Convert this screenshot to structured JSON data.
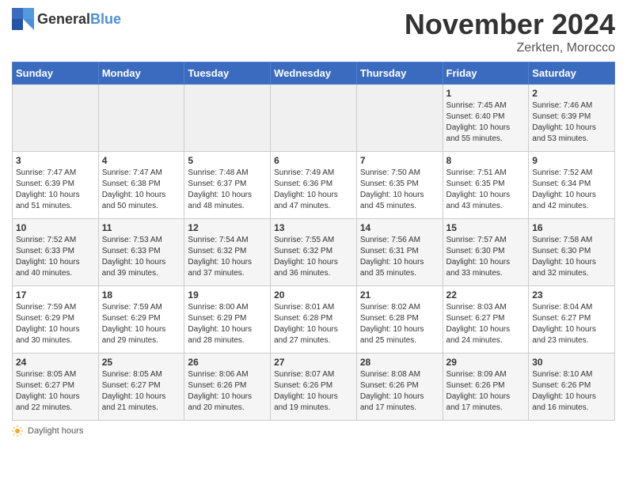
{
  "header": {
    "logo_general": "General",
    "logo_blue": "Blue",
    "month_title": "November 2024",
    "location": "Zerkten, Morocco"
  },
  "days_of_week": [
    "Sunday",
    "Monday",
    "Tuesday",
    "Wednesday",
    "Thursday",
    "Friday",
    "Saturday"
  ],
  "footer": {
    "daylight_hours_label": "Daylight hours"
  },
  "weeks": [
    {
      "days": [
        {
          "num": "",
          "info": ""
        },
        {
          "num": "",
          "info": ""
        },
        {
          "num": "",
          "info": ""
        },
        {
          "num": "",
          "info": ""
        },
        {
          "num": "",
          "info": ""
        },
        {
          "num": "1",
          "info": "Sunrise: 7:45 AM\nSunset: 6:40 PM\nDaylight: 10 hours and 55 minutes."
        },
        {
          "num": "2",
          "info": "Sunrise: 7:46 AM\nSunset: 6:39 PM\nDaylight: 10 hours and 53 minutes."
        }
      ]
    },
    {
      "days": [
        {
          "num": "3",
          "info": "Sunrise: 7:47 AM\nSunset: 6:39 PM\nDaylight: 10 hours and 51 minutes."
        },
        {
          "num": "4",
          "info": "Sunrise: 7:47 AM\nSunset: 6:38 PM\nDaylight: 10 hours and 50 minutes."
        },
        {
          "num": "5",
          "info": "Sunrise: 7:48 AM\nSunset: 6:37 PM\nDaylight: 10 hours and 48 minutes."
        },
        {
          "num": "6",
          "info": "Sunrise: 7:49 AM\nSunset: 6:36 PM\nDaylight: 10 hours and 47 minutes."
        },
        {
          "num": "7",
          "info": "Sunrise: 7:50 AM\nSunset: 6:35 PM\nDaylight: 10 hours and 45 minutes."
        },
        {
          "num": "8",
          "info": "Sunrise: 7:51 AM\nSunset: 6:35 PM\nDaylight: 10 hours and 43 minutes."
        },
        {
          "num": "9",
          "info": "Sunrise: 7:52 AM\nSunset: 6:34 PM\nDaylight: 10 hours and 42 minutes."
        }
      ]
    },
    {
      "days": [
        {
          "num": "10",
          "info": "Sunrise: 7:52 AM\nSunset: 6:33 PM\nDaylight: 10 hours and 40 minutes."
        },
        {
          "num": "11",
          "info": "Sunrise: 7:53 AM\nSunset: 6:33 PM\nDaylight: 10 hours and 39 minutes."
        },
        {
          "num": "12",
          "info": "Sunrise: 7:54 AM\nSunset: 6:32 PM\nDaylight: 10 hours and 37 minutes."
        },
        {
          "num": "13",
          "info": "Sunrise: 7:55 AM\nSunset: 6:32 PM\nDaylight: 10 hours and 36 minutes."
        },
        {
          "num": "14",
          "info": "Sunrise: 7:56 AM\nSunset: 6:31 PM\nDaylight: 10 hours and 35 minutes."
        },
        {
          "num": "15",
          "info": "Sunrise: 7:57 AM\nSunset: 6:30 PM\nDaylight: 10 hours and 33 minutes."
        },
        {
          "num": "16",
          "info": "Sunrise: 7:58 AM\nSunset: 6:30 PM\nDaylight: 10 hours and 32 minutes."
        }
      ]
    },
    {
      "days": [
        {
          "num": "17",
          "info": "Sunrise: 7:59 AM\nSunset: 6:29 PM\nDaylight: 10 hours and 30 minutes."
        },
        {
          "num": "18",
          "info": "Sunrise: 7:59 AM\nSunset: 6:29 PM\nDaylight: 10 hours and 29 minutes."
        },
        {
          "num": "19",
          "info": "Sunrise: 8:00 AM\nSunset: 6:29 PM\nDaylight: 10 hours and 28 minutes."
        },
        {
          "num": "20",
          "info": "Sunrise: 8:01 AM\nSunset: 6:28 PM\nDaylight: 10 hours and 27 minutes."
        },
        {
          "num": "21",
          "info": "Sunrise: 8:02 AM\nSunset: 6:28 PM\nDaylight: 10 hours and 25 minutes."
        },
        {
          "num": "22",
          "info": "Sunrise: 8:03 AM\nSunset: 6:27 PM\nDaylight: 10 hours and 24 minutes."
        },
        {
          "num": "23",
          "info": "Sunrise: 8:04 AM\nSunset: 6:27 PM\nDaylight: 10 hours and 23 minutes."
        }
      ]
    },
    {
      "days": [
        {
          "num": "24",
          "info": "Sunrise: 8:05 AM\nSunset: 6:27 PM\nDaylight: 10 hours and 22 minutes."
        },
        {
          "num": "25",
          "info": "Sunrise: 8:05 AM\nSunset: 6:27 PM\nDaylight: 10 hours and 21 minutes."
        },
        {
          "num": "26",
          "info": "Sunrise: 8:06 AM\nSunset: 6:26 PM\nDaylight: 10 hours and 20 minutes."
        },
        {
          "num": "27",
          "info": "Sunrise: 8:07 AM\nSunset: 6:26 PM\nDaylight: 10 hours and 19 minutes."
        },
        {
          "num": "28",
          "info": "Sunrise: 8:08 AM\nSunset: 6:26 PM\nDaylight: 10 hours and 17 minutes."
        },
        {
          "num": "29",
          "info": "Sunrise: 8:09 AM\nSunset: 6:26 PM\nDaylight: 10 hours and 17 minutes."
        },
        {
          "num": "30",
          "info": "Sunrise: 8:10 AM\nSunset: 6:26 PM\nDaylight: 10 hours and 16 minutes."
        }
      ]
    }
  ]
}
